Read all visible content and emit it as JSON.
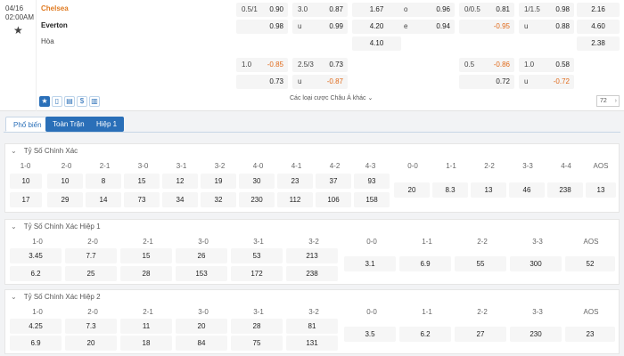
{
  "match": {
    "date": "04/16",
    "time": "02:00AM",
    "home": "Chelsea",
    "away": "Everton",
    "draw": "Hòa",
    "odds_row1": [
      {
        "l": "0.5/1",
        "r": "0.90"
      },
      {
        "l": "3.0",
        "r": "0.87"
      },
      {
        "c": "1.67"
      },
      {
        "l": "o",
        "r": "0.96"
      },
      {
        "l": "0/0.5",
        "r": "0.81"
      },
      {
        "l": "1/1.5",
        "r": "0.98"
      },
      {
        "c": "2.16"
      }
    ],
    "odds_row2": [
      {
        "l": "",
        "r": "0.98"
      },
      {
        "l": "u",
        "r": "0.99"
      },
      {
        "c": "4.20"
      },
      {
        "l": "e",
        "r": "0.94"
      },
      {
        "l": "",
        "r": "-0.95"
      },
      {
        "l": "u",
        "r": "0.88"
      },
      {
        "c": "4.60"
      }
    ],
    "odds_row3": [
      {
        "c": "4.10"
      },
      {
        "c": "2.38"
      }
    ],
    "odds_row4": [
      {
        "l": "1.0",
        "r": "-0.85"
      },
      {
        "l": "2.5/3",
        "r": "0.73"
      },
      {
        "l": "0.5",
        "r": "-0.86"
      },
      {
        "l": "1.0",
        "r": "0.58"
      }
    ],
    "odds_row5": [
      {
        "l": "",
        "r": "0.73"
      },
      {
        "l": "u",
        "r": "-0.87"
      },
      {
        "l": "",
        "r": "0.72"
      },
      {
        "l": "u",
        "r": "-0.72"
      }
    ],
    "more_bets": "Các loại cược Châu Á khác",
    "count": "72"
  },
  "tabs": [
    "Phổ biến",
    "Toàn Trận",
    "Hiệp 1"
  ],
  "sections": [
    {
      "title": "Tỷ Số Chính Xác",
      "left_headers": [
        "1-0",
        "2-0",
        "2-1",
        "3-0",
        "3-1",
        "3-2",
        "4-0",
        "4-1",
        "4-2",
        "4-3"
      ],
      "left_row1": [
        "10",
        "10",
        "8",
        "15",
        "12",
        "19",
        "30",
        "23",
        "37",
        "93"
      ],
      "left_row2": [
        "17",
        "29",
        "14",
        "73",
        "34",
        "32",
        "230",
        "112",
        "106",
        "158"
      ],
      "right_headers": [
        "0-0",
        "1-1",
        "2-2",
        "3-3",
        "4-4",
        "AOS"
      ],
      "right_row": [
        "20",
        "8.3",
        "13",
        "46",
        "238",
        "13"
      ]
    },
    {
      "title": "Tỷ Số Chính Xác Hiệp 1",
      "left_headers": [
        "1-0",
        "2-0",
        "2-1",
        "3-0",
        "3-1",
        "3-2"
      ],
      "left_row1": [
        "3.45",
        "7.7",
        "15",
        "26",
        "53",
        "213"
      ],
      "left_row2": [
        "6.2",
        "25",
        "28",
        "153",
        "172",
        "238"
      ],
      "right_headers": [
        "0-0",
        "1-1",
        "2-2",
        "3-3",
        "AOS"
      ],
      "right_row": [
        "3.1",
        "6.9",
        "55",
        "300",
        "52"
      ]
    },
    {
      "title": "Tỷ Số Chính Xác Hiệp 2",
      "left_headers": [
        "1-0",
        "2-0",
        "2-1",
        "3-0",
        "3-1",
        "3-2"
      ],
      "left_row1": [
        "4.25",
        "7.3",
        "11",
        "20",
        "28",
        "81"
      ],
      "left_row2": [
        "6.9",
        "20",
        "18",
        "84",
        "75",
        "131"
      ],
      "right_headers": [
        "0-0",
        "1-1",
        "2-2",
        "3-3",
        "AOS"
      ],
      "right_row": [
        "3.5",
        "6.2",
        "27",
        "230",
        "23"
      ]
    }
  ]
}
